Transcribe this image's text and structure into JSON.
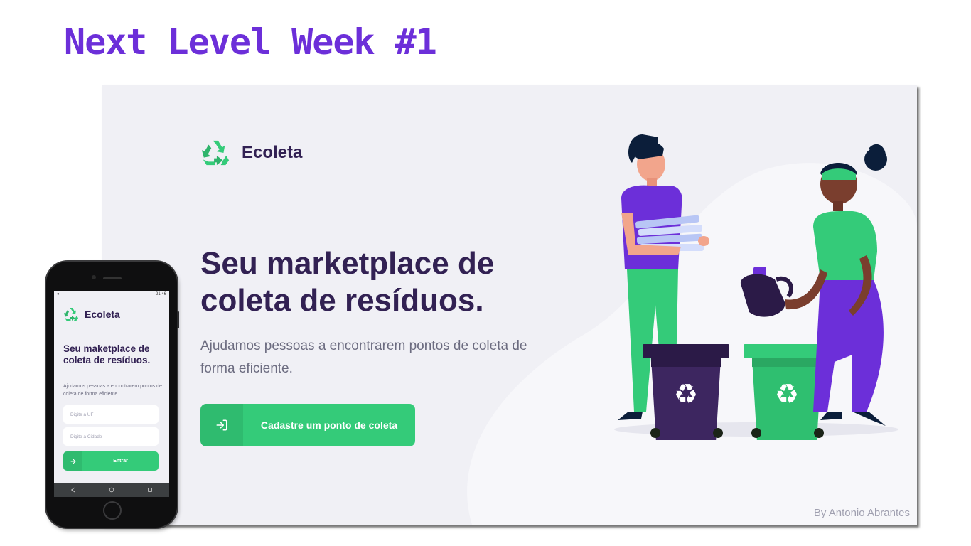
{
  "banner": {
    "title": "Next Level Week #1"
  },
  "desktop": {
    "logo_text": "Ecoleta",
    "headline_line1": "Seu marketplace de",
    "headline_line2": "coleta de resíduos.",
    "subtext": "Ajudamos pessoas a encontrarem pontos de coleta de forma eficiente.",
    "cta_label": "Cadastre um ponto de coleta",
    "credit": "By Antonio Abrantes"
  },
  "phone": {
    "status_time": "21:46",
    "logo_text": "Ecoleta",
    "title": "Seu maketplace de coleta de resíduos.",
    "description": "Ajudamos pessoas a encontrarem pontos de coleta de forma eficiente.",
    "uf_placeholder": "Digite a UF",
    "city_placeholder": "Digite a Cidade",
    "button_label": "Entrar"
  },
  "colors": {
    "accent_purple": "#6c2fd9",
    "brand_green": "#34cb79",
    "title_dark": "#322153",
    "text_gray": "#6c6c80",
    "background": "#f0f0f5"
  },
  "icons": {
    "logo": "recycle-icon",
    "cta": "log-in-icon",
    "phone_button": "arrow-right-icon"
  }
}
